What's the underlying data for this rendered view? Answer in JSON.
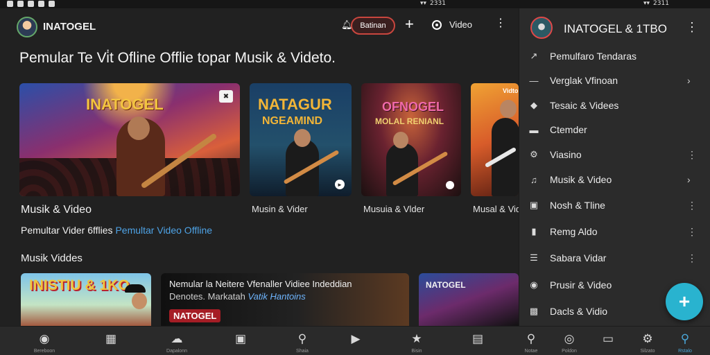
{
  "status_bar": {
    "time_left": "2331",
    "time_right": "2311"
  },
  "header": {
    "app_title": "INATOGEL",
    "pill_button": "Batinan",
    "video_label": "Video"
  },
  "main": {
    "heading": "Pemular Te Vi̇t Ofline Offlie topar Musik & Videto.",
    "cards": [
      {
        "thumb_title": "INATOGEL",
        "caption": "Musik & Video"
      },
      {
        "thumb_title_1": "NATAGUR",
        "thumb_title_2": "NGEAMIND",
        "caption": "Musin & Vider"
      },
      {
        "thumb_title_1": "OFNOGEL",
        "thumb_title_2": "MOLAL RENIANL",
        "caption": "Musuia & Vlder"
      },
      {
        "thumb_title": "Vidto",
        "caption": "Musal & Vid"
      }
    ],
    "sub_row": {
      "text": "Pemultar Vider 6fflies",
      "link": "Pemultar Video Offline"
    },
    "section_title": "Musik Viddes",
    "bottom_cards": [
      {
        "title": "INISTIU & 1KO"
      },
      {
        "line1": "Nemular la Neitere Vfenaller Vidiee Indeddian",
        "line2_prefix": "Denotes. Markatah ",
        "line2_highlight": "Vatik Hantoins",
        "logo": "NATOGEL"
      },
      {
        "title": "NATOGEL"
      }
    ]
  },
  "drawer": {
    "title": "INATOGEL & 1TBO",
    "items": [
      {
        "icon": "arrow-up-icon",
        "label": "Pemulfaro Tendaras",
        "tail": ""
      },
      {
        "icon": "dash-icon",
        "label": "Verglak Vfinoan",
        "tail": "›"
      },
      {
        "icon": "tag-icon",
        "label": "Tesaic & Videes",
        "tail": ""
      },
      {
        "icon": "card-icon",
        "label": "Ctemder",
        "tail": ""
      },
      {
        "icon": "gear-icon",
        "label": "Viasino",
        "tail": "⋮"
      },
      {
        "icon": "music-icon",
        "label": "Musik & Video",
        "tail": "›"
      },
      {
        "icon": "square-icon",
        "label": "Nosh & Tline",
        "tail": "⋮"
      },
      {
        "icon": "doc-icon",
        "label": "Remg Aldo",
        "tail": "⋮"
      },
      {
        "icon": "list-icon",
        "label": "Sabara Vidar",
        "tail": "⋮"
      },
      {
        "icon": "camera-icon",
        "label": "Prusir & Video",
        "tail": ""
      },
      {
        "icon": "box-icon",
        "label": "Dacls & Vidio",
        "tail": ""
      }
    ]
  },
  "bottom_nav": [
    {
      "icon": "home-icon",
      "label": "Bereboon"
    },
    {
      "icon": "library-icon",
      "label": ""
    },
    {
      "icon": "cloud-icon",
      "label": "Dapalonn"
    },
    {
      "icon": "briefcase-icon",
      "label": ""
    },
    {
      "icon": "search-icon",
      "label": "Shaia"
    },
    {
      "icon": "play-icon",
      "label": ""
    },
    {
      "icon": "star-icon",
      "label": "Bisin"
    },
    {
      "icon": "inbox-icon",
      "label": ""
    },
    {
      "icon": "search-icon",
      "label": "Notae"
    },
    {
      "icon": "globe-icon",
      "label": "Poldon"
    },
    {
      "icon": "chat-icon",
      "label": ""
    },
    {
      "icon": "settings-icon",
      "label": "Silzato"
    },
    {
      "icon": "search-icon",
      "label": "Rstalo"
    }
  ],
  "colors": {
    "accent": "#29b3cf",
    "link": "#4ea3e6",
    "pill_border": "#c9463e"
  }
}
